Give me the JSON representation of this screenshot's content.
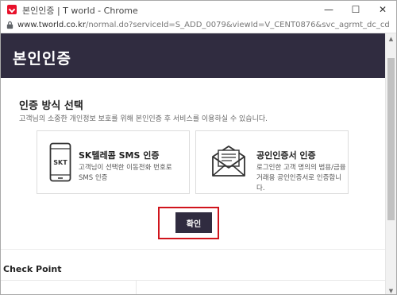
{
  "window": {
    "title": "본인인증 | T world - Chrome",
    "minimize": "—",
    "maximize": "☐",
    "close": "✕"
  },
  "address": {
    "url_host": "www.tworld.co.kr",
    "url_path": "/normal.do?serviceId=S_ADD_0079&viewId=V_CENT0876&svc_agrmt_dc_cd=AG&agrmt_ch"
  },
  "header": {
    "title": "본인인증"
  },
  "auth": {
    "section_title": "인증 방식 선택",
    "description": "고객님의 소중한 개인정보 보호를 위해 본인인증 후 서비스를 이용하실 수 있습니다.",
    "options": [
      {
        "icon": "phone-skt-icon",
        "icon_label": "SKT",
        "title": "SK텔레콤 SMS 인증",
        "desc_line1": "고객님이 선택한 이동전화 번호로",
        "desc_line2": "SMS 인증"
      },
      {
        "icon": "envelope-icon",
        "title": "공인인증서 인증",
        "desc_line1": "로그인한 고객 명의의 범용/금융",
        "desc_line2": "거래용 공인인증서로 인증합니다."
      }
    ],
    "confirm_label": "확인"
  },
  "footer": {
    "checkpoint_title": "Check Point"
  },
  "colors": {
    "header_bg": "#302c40",
    "button_bg": "#302c40",
    "highlight": "#d0141c",
    "brand": "#e8102a"
  }
}
